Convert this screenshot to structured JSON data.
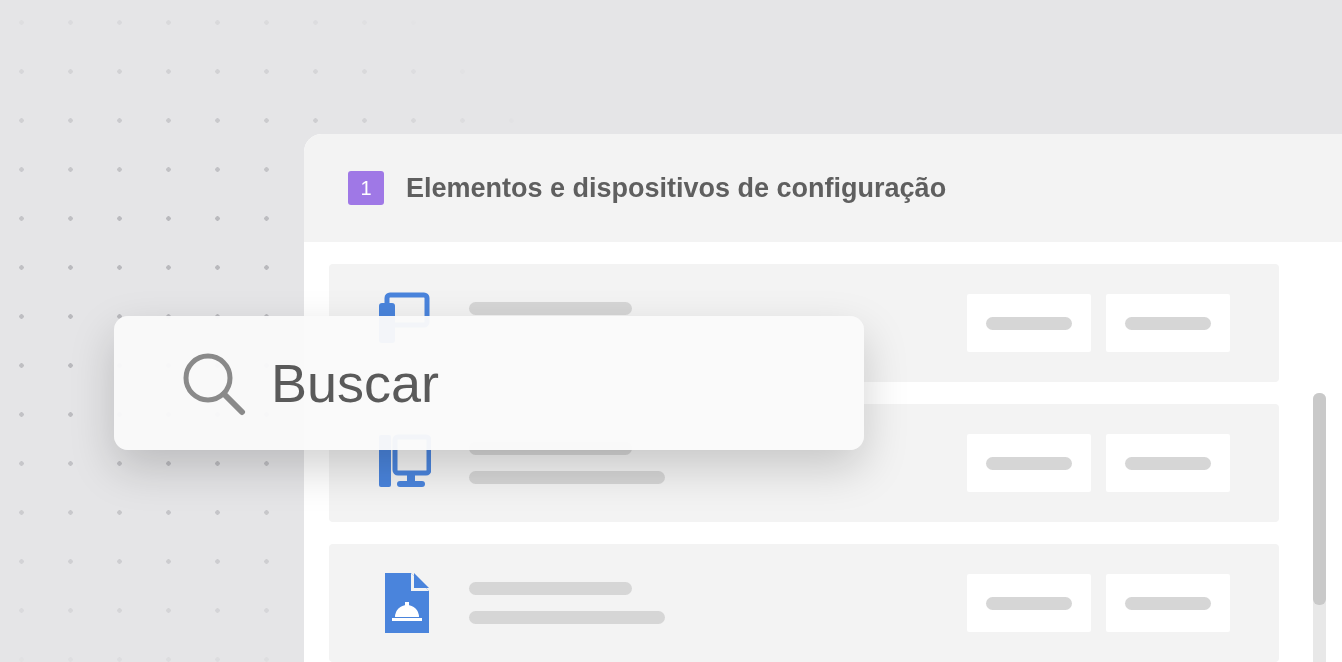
{
  "panel": {
    "badge": "1",
    "title": "Elementos e dispositivos de configuração"
  },
  "search": {
    "placeholder": "Buscar"
  },
  "rows": [
    {
      "kind": "devices"
    },
    {
      "kind": "desktop"
    },
    {
      "kind": "document"
    }
  ]
}
